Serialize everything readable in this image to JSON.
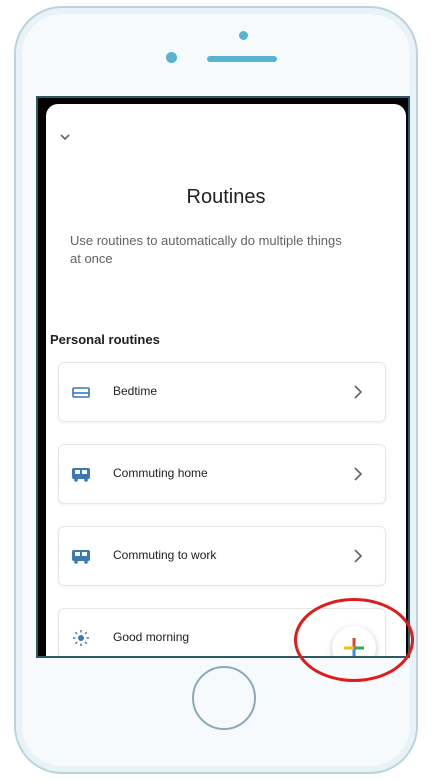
{
  "screen": {
    "title": "Routines",
    "subtitle": "Use routines to automatically do multiple things at once",
    "section_label": "Personal routines"
  },
  "routines": [
    {
      "label": "Bedtime",
      "icon": "bed-icon"
    },
    {
      "label": "Commuting home",
      "icon": "bus-icon"
    },
    {
      "label": "Commuting to work",
      "icon": "bus-icon"
    },
    {
      "label": "Good morning",
      "icon": "sun-icon"
    }
  ],
  "icons": {
    "collapse": "chevron-down-icon",
    "row_arrow": "chevron-right-icon",
    "add": "plus-icon"
  },
  "colors": {
    "accent_blue": "#3c78b4",
    "highlight_red": "#e01b1b",
    "plus_red": "#ea4335",
    "plus_yellow": "#fbbc05",
    "plus_green": "#34a853",
    "plus_blue": "#4285f4"
  }
}
